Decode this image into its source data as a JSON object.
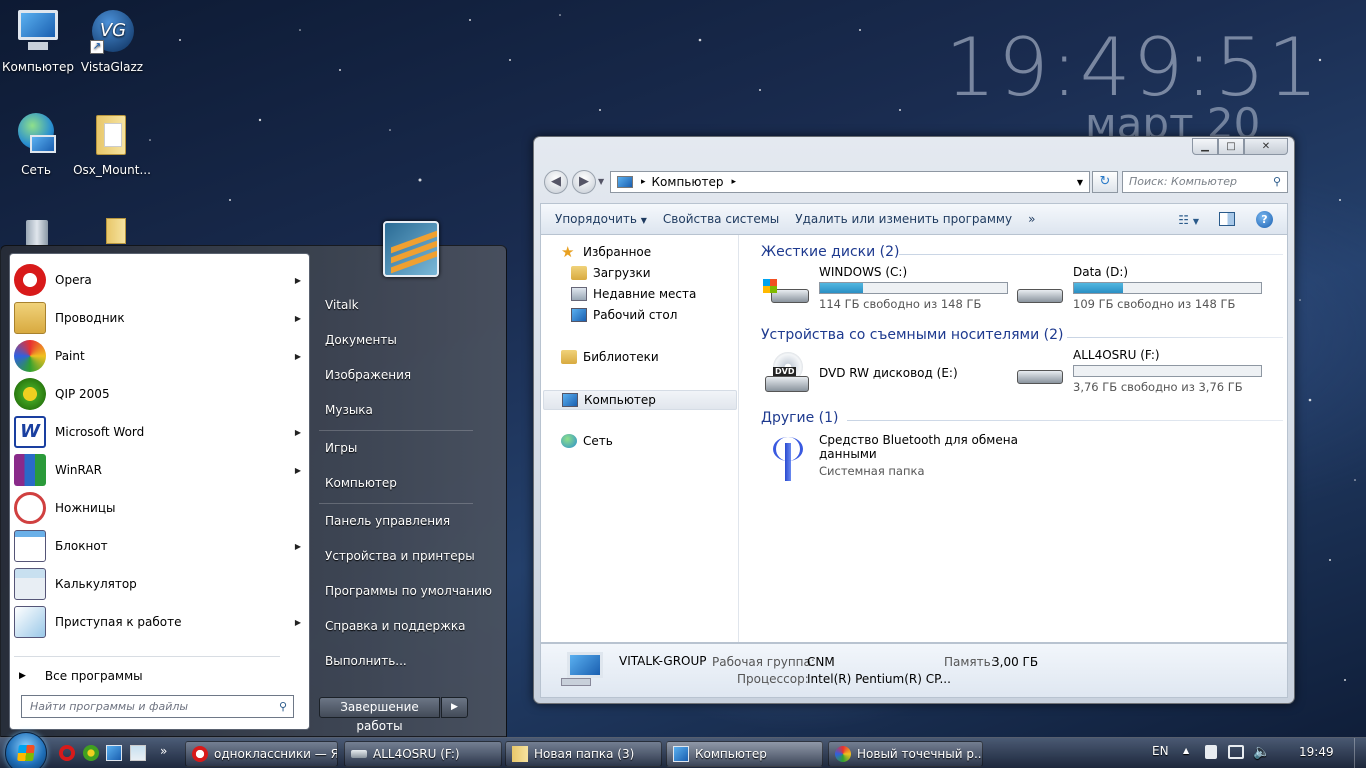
{
  "clock": {
    "time": "19:49:51",
    "date": "март 20"
  },
  "desktop": {
    "icons": [
      {
        "label": "Компьютер"
      },
      {
        "label": "VistaGlazz"
      },
      {
        "label": "Сеть"
      },
      {
        "label": "Osx_Mount..."
      }
    ]
  },
  "explorer": {
    "nav": {
      "back_icon": "back-arrow-icon",
      "forward_icon": "forward-arrow-icon"
    },
    "address": {
      "location": "Компьютер",
      "sep": "▸"
    },
    "search": {
      "placeholder": "Поиск: Компьютер"
    },
    "toolbar": {
      "organize": "Упорядочить",
      "sysprops": "Свойства системы",
      "uninstall": "Удалить или изменить программу",
      "more": "»"
    },
    "navpane": {
      "favorites": "Избранное",
      "downloads": "Загрузки",
      "recent": "Недавние места",
      "desktop": "Рабочий стол",
      "libraries": "Библиотеки",
      "computer": "Компьютер",
      "network": "Сеть"
    },
    "groups": {
      "hdd": "Жесткие диски (2)",
      "removable": "Устройства со съемными носителями (2)",
      "other": "Другие (1)"
    },
    "drives": {
      "c": {
        "name": "WINDOWS (C:)",
        "free": "114 ГБ свободно из 148 ГБ",
        "used_fraction": 0.23
      },
      "d": {
        "name": "Data (D:)",
        "free": "109 ГБ свободно из 148 ГБ",
        "used_fraction": 0.26
      },
      "e": {
        "name": "DVD RW дисковод (E:)",
        "badge": "DVD"
      },
      "f": {
        "name": "ALL4OSRU (F:)",
        "free": "3,76 ГБ свободно из 3,76 ГБ",
        "used_fraction": 0.0
      },
      "bt": {
        "name1": "Средство Bluetooth для обмена",
        "name2": "данными",
        "type": "Системная папка"
      }
    },
    "details": {
      "pc": "VITALK-GROUP",
      "wg_label": "Рабочая группа:",
      "wg": "CNM",
      "mem_label": "Память:",
      "mem": "3,00 ГБ",
      "cpu_label": "Процессор:",
      "cpu": "Intel(R) Pentium(R) CP..."
    }
  },
  "startmenu": {
    "programs": [
      {
        "label": "Opera",
        "arrow": "▶"
      },
      {
        "label": "Проводник",
        "arrow": "▶"
      },
      {
        "label": "Paint",
        "arrow": "▶"
      },
      {
        "label": "QIP 2005",
        "arrow": ""
      },
      {
        "label": "Microsoft Word",
        "arrow": "▶"
      },
      {
        "label": "WinRAR",
        "arrow": "▶"
      },
      {
        "label": "Ножницы",
        "arrow": ""
      },
      {
        "label": "Блокнот",
        "arrow": "▶"
      },
      {
        "label": "Калькулятор",
        "arrow": ""
      },
      {
        "label": "Приступая к работе",
        "arrow": "▶"
      }
    ],
    "all_programs": "Все программы",
    "all_arrow": "▶",
    "search_placeholder": "Найти программы и файлы",
    "right": [
      "Vitalk",
      "Документы",
      "Изображения",
      "Музыка",
      "Игры",
      "Компьютер",
      "Панель управления",
      "Устройства и принтеры",
      "Программы по умолчанию",
      "Справка и поддержка",
      "Выполнить..."
    ],
    "shutdown": "Завершение работы",
    "shutdown_arrow": "▶"
  },
  "taskbar": {
    "items": [
      {
        "label": "одноклассники — Я..."
      },
      {
        "label": "ALL4OSRU (F:)"
      },
      {
        "label": "Новая папка (3)"
      },
      {
        "label": "Компьютер"
      },
      {
        "label": "Новый точечный р..."
      }
    ],
    "more": "»",
    "lang": "EN",
    "tray_arrow": "▲",
    "time": "19:49"
  },
  "colors": {
    "accent": "#1e3a8f",
    "taskbar": "#2a3a58",
    "desktop": "#1a2c50"
  }
}
